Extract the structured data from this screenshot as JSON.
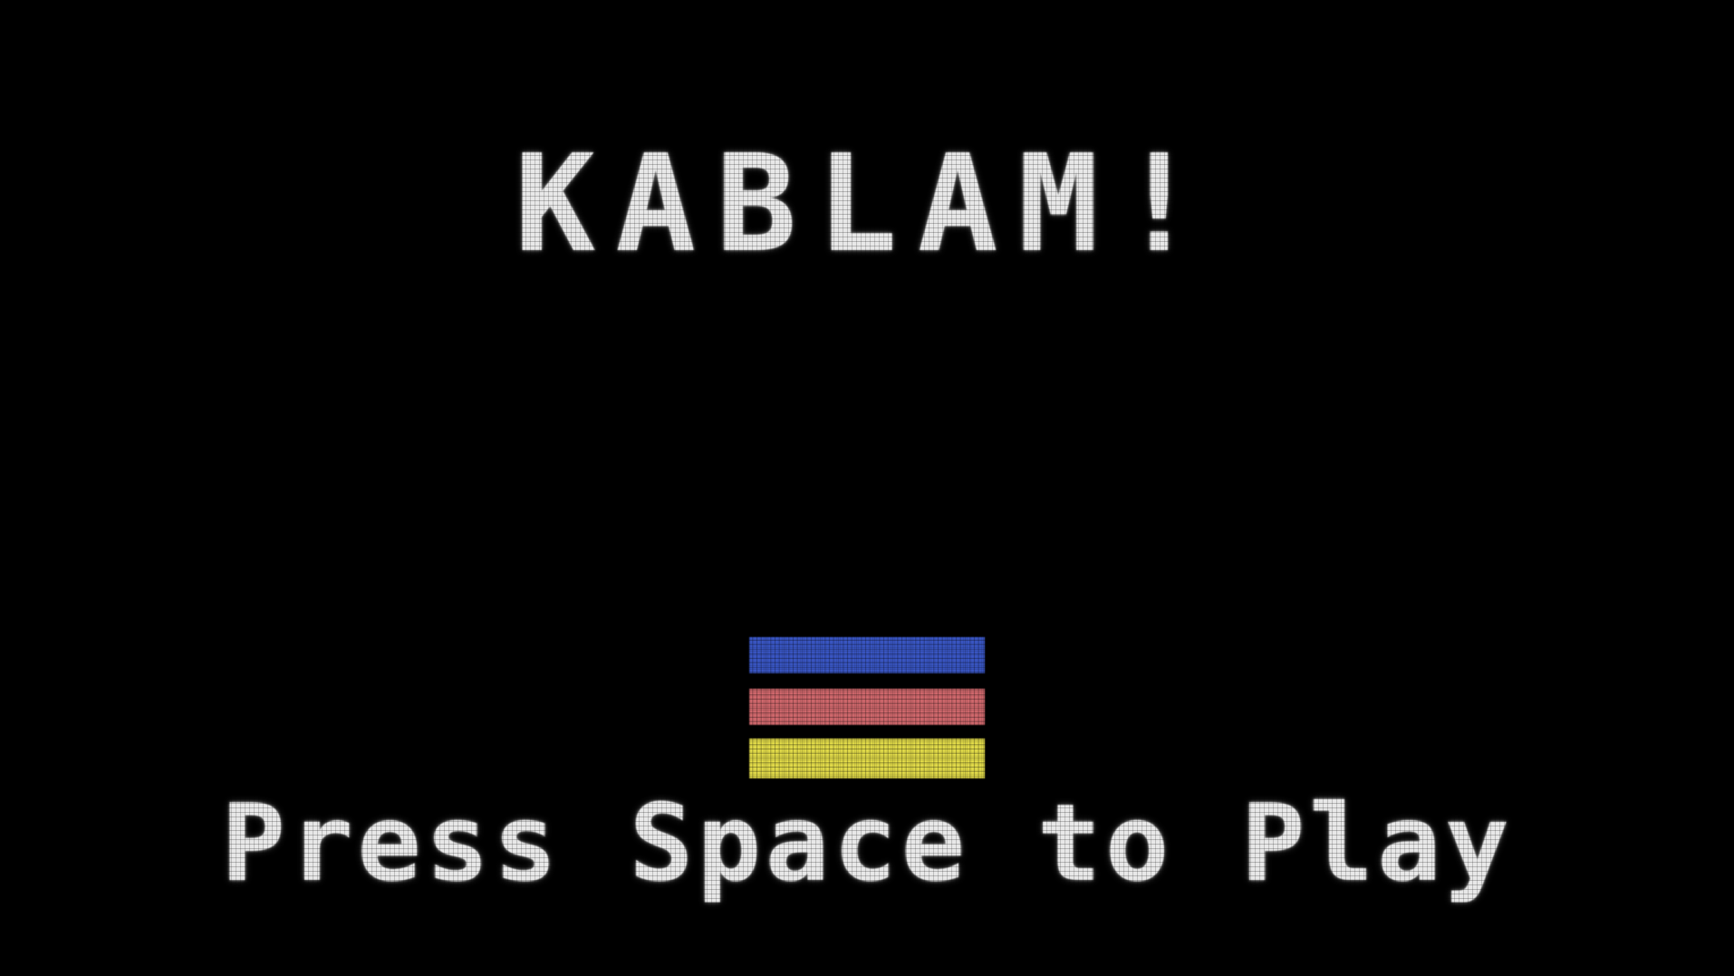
{
  "game": {
    "title": "KABLAM!",
    "prompt": "Press Space to Play"
  },
  "bricks": [
    {
      "color": "#3a57c7"
    },
    {
      "color": "#d46a6f"
    },
    {
      "color": "#e6df4a"
    }
  ]
}
